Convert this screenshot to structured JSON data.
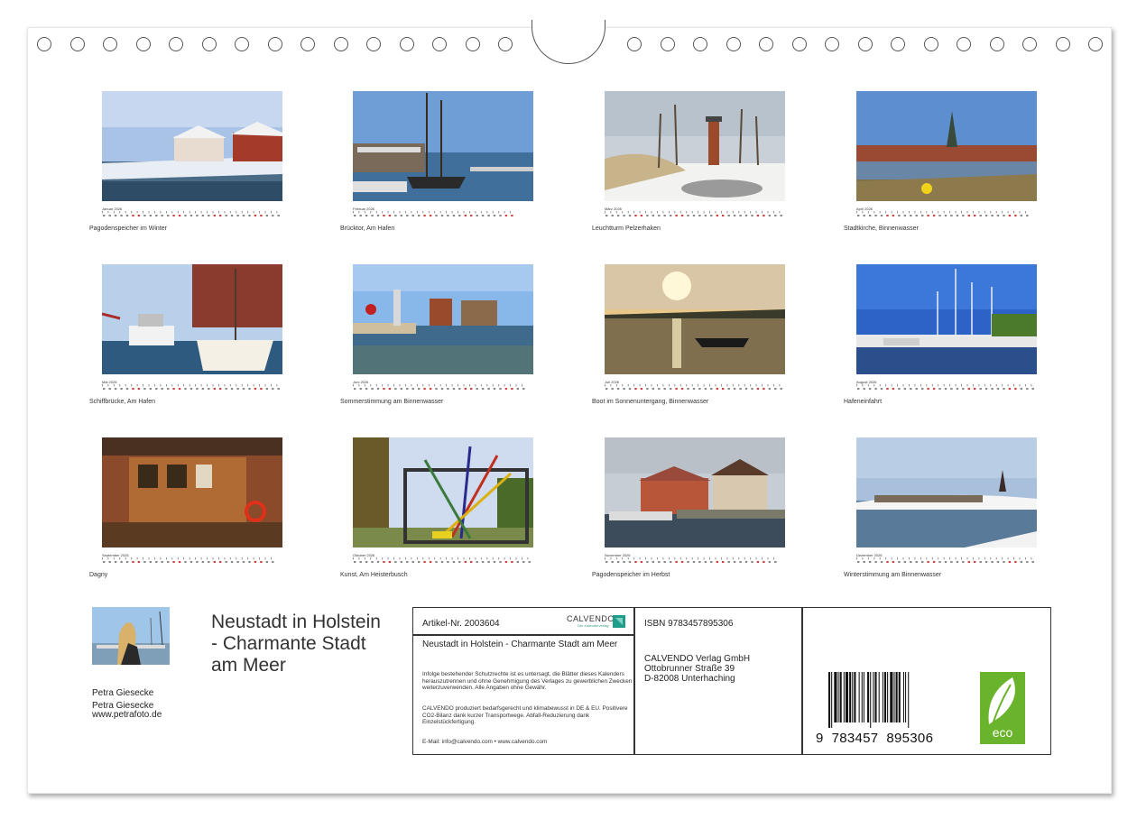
{
  "months": [
    {
      "key": "jan",
      "name": "Januar 2026",
      "caption": "Pagodenspeicher im Winter"
    },
    {
      "key": "feb",
      "name": "Februar 2026",
      "caption": "Brücktor, Am Hafen"
    },
    {
      "key": "mar",
      "name": "März 2026",
      "caption": "Leuchtturm Pelzerhaken"
    },
    {
      "key": "apr",
      "name": "April 2026",
      "caption": "Stadtkirche, Binnenwasser"
    },
    {
      "key": "may",
      "name": "Mai 2026",
      "caption": "Schiffbrücke, Am Hafen"
    },
    {
      "key": "jun",
      "name": "Juni 2026",
      "caption": "Sommerstimmung am Binnenwasser"
    },
    {
      "key": "jul",
      "name": "Juli 2026",
      "caption": "Boot im Sonnenuntergang, Binnenwasser"
    },
    {
      "key": "aug",
      "name": "August 2026",
      "caption": "Hafeneinfahrt"
    },
    {
      "key": "sep",
      "name": "September 2026",
      "caption": "Dagny"
    },
    {
      "key": "oct",
      "name": "Oktober 2026",
      "caption": "Kunst, Am Heisterbusch"
    },
    {
      "key": "nov",
      "name": "November 2026",
      "caption": "Pagodenspeicher im Herbst"
    },
    {
      "key": "dec",
      "name": "Dezember 2026",
      "caption": "Winterstimmung am Binnenwasser"
    }
  ],
  "author": {
    "line1": "Petra Giesecke",
    "line2": "Petra Giesecke",
    "line3": "www.petrafoto.de"
  },
  "title": "Neustadt in Holstein - Charmante Stadt am Meer",
  "info": {
    "article": "Artikel-Nr. 2003604",
    "brand": "CALVENDO",
    "brand_tagline": "Der Kalenderverlag",
    "product_title": "Neustadt in Holstein - Charmante Stadt am Meer",
    "legal": "Infolge bestehender Schutzrechte ist es untersagt, die Blätter dieses Kalenders herauszutrennen und ohne Genehmigung des Verlages zu gewerblichen Zwecken weiterzuverwenden. Alle Angaben ohne Gewähr.",
    "eco": "CALVENDO produziert bedarfsgerecht und klimabewusst in DE & EU. Positivere CO2-Bilanz dank kurzer Transportwege. Abfall-Reduzierung dank Einzelstückfertigung.",
    "contact": "E-Mail: info@calvendo.com • www.calvendo.com",
    "isbn": "ISBN 9783457895306",
    "publisher1": "CALVENDO Verlag GmbH",
    "publisher2": "Ottobrunner Straße 39",
    "publisher3": "D-82008 Unterhaching",
    "barcode_digits": "9  783457  895306",
    "eco_label": "eco"
  }
}
